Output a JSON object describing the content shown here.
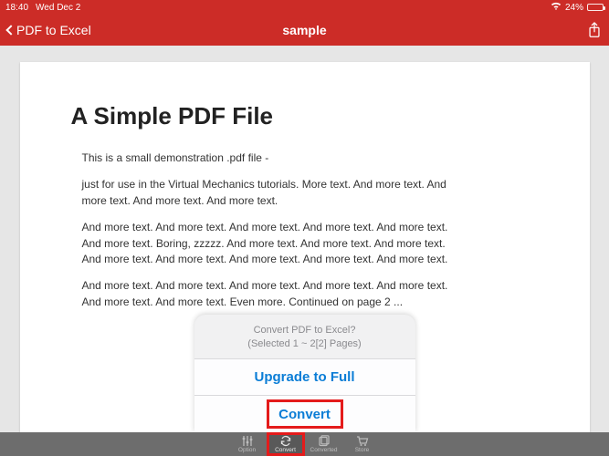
{
  "status": {
    "time": "18:40",
    "date": "Wed Dec 2",
    "battery_pct": "24%"
  },
  "nav": {
    "back_label": "PDF to Excel",
    "title": "sample"
  },
  "document": {
    "heading": "A Simple PDF File",
    "paragraphs": [
      "This is a small demonstration .pdf file -",
      "just for use in the Virtual Mechanics tutorials. More text. And more text. And more text. And more text. And more text.",
      "And more text. And more text. And more text. And more text. And more text. And more text. Boring, zzzzz. And more text. And more text. And more text. And more text. And more text. And more text. And more text. And more text.",
      "And more text. And more text. And more text. And more text. And more text. And more text. And more text. Even more. Continued on page 2 ..."
    ]
  },
  "sheet": {
    "line1": "Convert PDF to Excel?",
    "line2": "(Selected 1 ~ 2[2] Pages)",
    "upgrade": "Upgrade to Full",
    "convert": "Convert"
  },
  "tabs": {
    "option": "Option",
    "convert": "Convert",
    "converted": "Converted",
    "store": "Store"
  }
}
